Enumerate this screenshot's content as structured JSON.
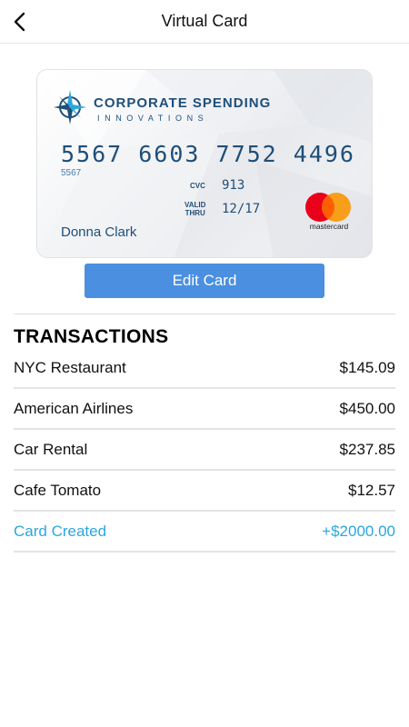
{
  "header": {
    "title": "Virtual Card",
    "back_icon": "chevron-left-icon"
  },
  "card": {
    "brand_line1": "CORPORATE SPENDING",
    "brand_line2": "INNOVATIONS",
    "number": "5567 6603 7752 4496",
    "number_short": "5567",
    "cvc_label": "CVC",
    "cvc": "913",
    "valid_label_1": "VALID",
    "valid_label_2": "THRU",
    "valid_thru": "12/17",
    "cardholder": "Donna Clark",
    "network": "mastercard",
    "network_colors": {
      "red": "#eb001b",
      "yellow": "#f79e1b",
      "overlap": "#ff5f00"
    },
    "text_color": "#1f4e78"
  },
  "actions": {
    "edit_label": "Edit Card",
    "button_color": "#4a8fe0"
  },
  "transactions": {
    "title": "TRANSACTIONS",
    "items": [
      {
        "name": "NYC Restaurant",
        "amount": "$145.09",
        "type": "debit"
      },
      {
        "name": "American Airlines",
        "amount": "$450.00",
        "type": "debit"
      },
      {
        "name": "Car Rental",
        "amount": "$237.85",
        "type": "debit"
      },
      {
        "name": "Cafe Tomato",
        "amount": "$12.57",
        "type": "debit"
      },
      {
        "name": "Card Created",
        "amount": "+$2000.00",
        "type": "credit"
      }
    ],
    "credit_color": "#2ba7de"
  }
}
